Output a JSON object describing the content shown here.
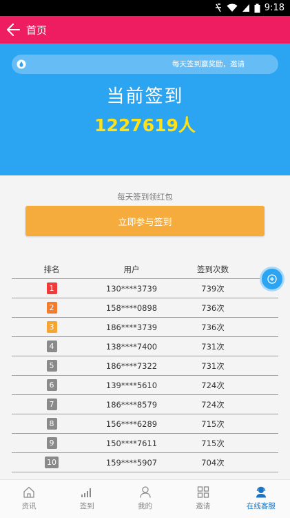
{
  "status_bar": {
    "time": "9:18"
  },
  "header": {
    "title": "首页"
  },
  "hero": {
    "notice": "每天签到赢奖励，邀请",
    "title": "当前签到",
    "count": "1227619人"
  },
  "checkin": {
    "hint": "每天签到领红包",
    "join_label": "立即参与签到"
  },
  "table": {
    "headers": {
      "rank": "排名",
      "user": "用户",
      "count": "签到次数"
    },
    "rows": [
      {
        "rank": "1",
        "user": "130****3739",
        "count": "739次"
      },
      {
        "rank": "2",
        "user": "158****0898",
        "count": "736次"
      },
      {
        "rank": "3",
        "user": "186****3739",
        "count": "736次"
      },
      {
        "rank": "4",
        "user": "138****7400",
        "count": "731次"
      },
      {
        "rank": "5",
        "user": "186****7322",
        "count": "731次"
      },
      {
        "rank": "6",
        "user": "139****5610",
        "count": "724次"
      },
      {
        "rank": "7",
        "user": "186****8579",
        "count": "724次"
      },
      {
        "rank": "8",
        "user": "156****6289",
        "count": "715次"
      },
      {
        "rank": "9",
        "user": "150****7611",
        "count": "715次"
      },
      {
        "rank": "10",
        "user": "159****5907",
        "count": "704次"
      }
    ],
    "badge_colors": [
      "#ef3b3b",
      "#f57c2c",
      "#f7a531",
      "#8a8a8a"
    ]
  },
  "tabs": [
    {
      "label": "资讯",
      "icon": "home-icon"
    },
    {
      "label": "签到",
      "icon": "bar-chart-icon"
    },
    {
      "label": "我的",
      "icon": "person-icon"
    },
    {
      "label": "邀请",
      "icon": "grid-icon"
    },
    {
      "label": "在线客服",
      "icon": "customer-service-icon",
      "active": true
    }
  ],
  "colors": {
    "header": "#ee1d62",
    "hero": "#2ba4f2",
    "count": "#ffe11a",
    "button": "#f5ac3c",
    "tab_active": "#1a74c4"
  }
}
